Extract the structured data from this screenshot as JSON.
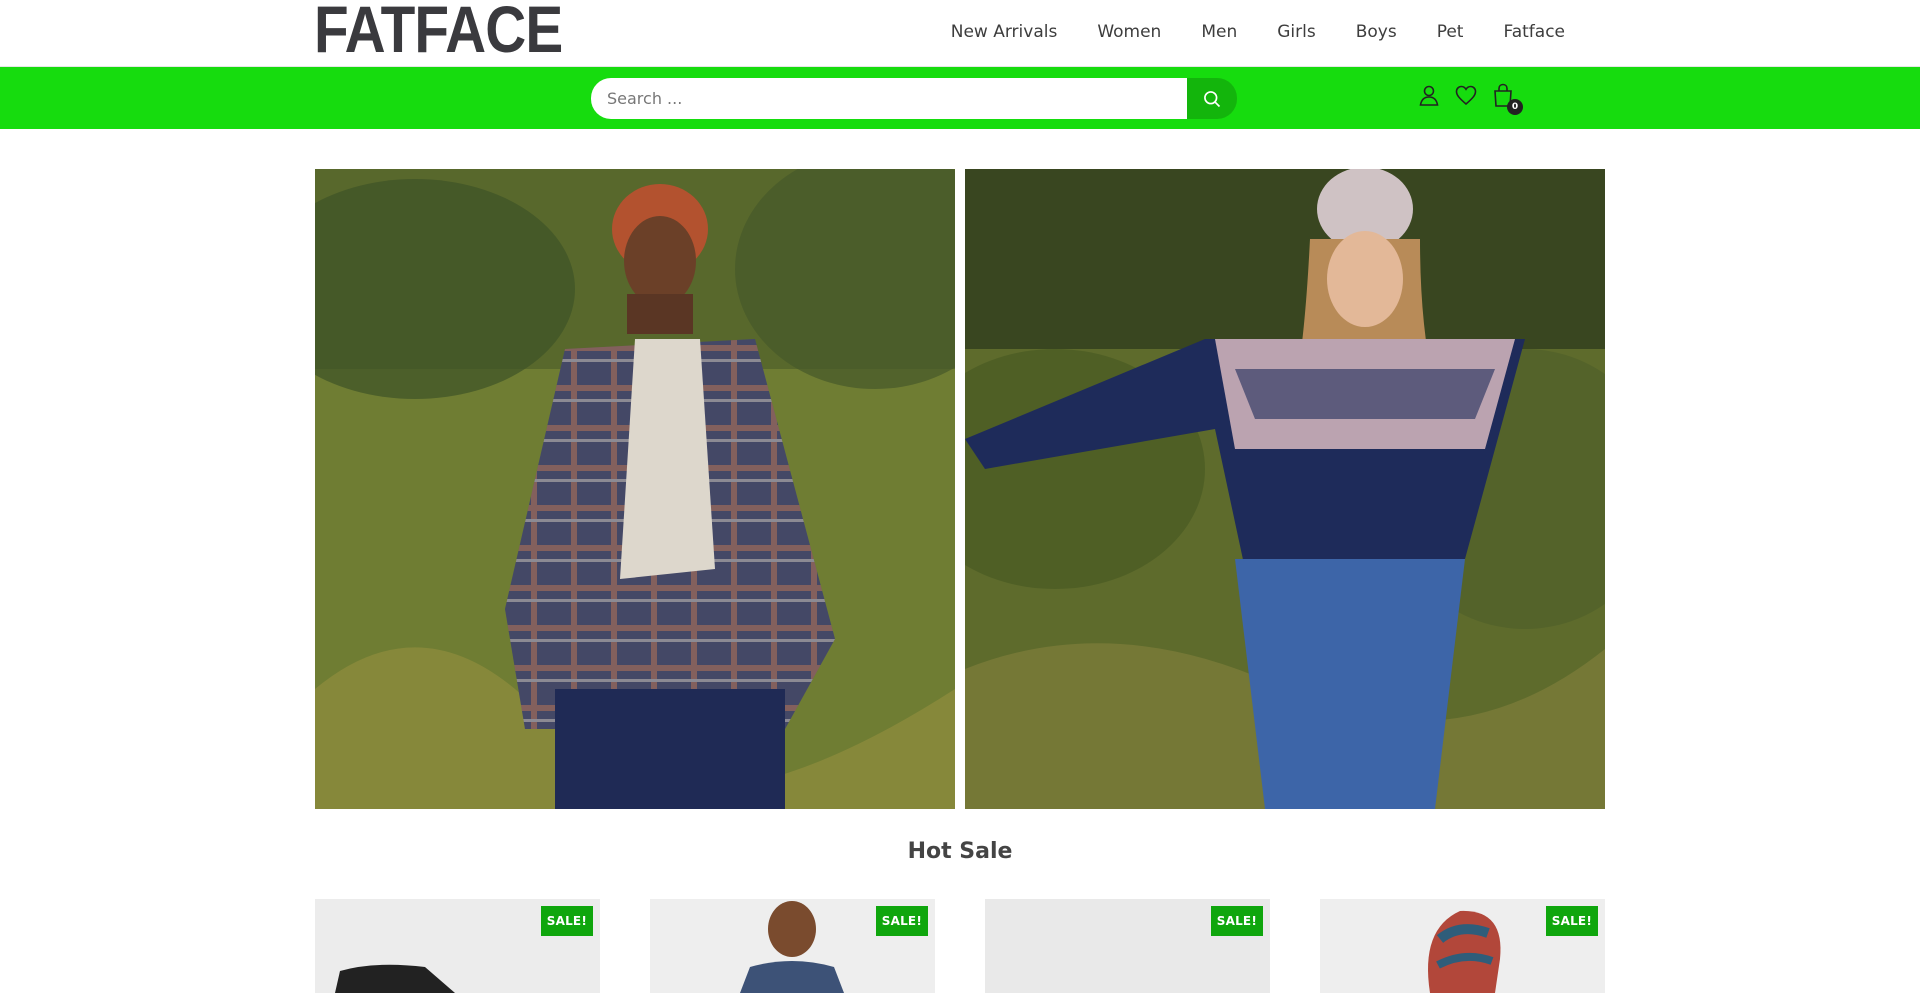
{
  "header": {
    "logo_text": "FATFACE",
    "nav_items": [
      {
        "label": "New Arrivals"
      },
      {
        "label": "Women"
      },
      {
        "label": "Men"
      },
      {
        "label": "Girls"
      },
      {
        "label": "Boys"
      },
      {
        "label": "Pet"
      },
      {
        "label": "Fatface"
      }
    ]
  },
  "search": {
    "placeholder": "Search ...",
    "button_icon": "search-icon"
  },
  "account_icons": {
    "user_icon": "user-icon",
    "wishlist_icon": "heart-icon",
    "cart_icon": "shopping-bag-icon",
    "cart_count": "0"
  },
  "hero": {
    "left_image": "man-in-plaid-shirt-and-beanie-photo",
    "right_image": "woman-in-fair-isle-sweater-photo"
  },
  "section": {
    "title": "Hot Sale"
  },
  "products": [
    {
      "badge": "SALE!"
    },
    {
      "badge": "SALE!"
    },
    {
      "badge": "SALE!"
    },
    {
      "badge": "SALE!"
    }
  ],
  "colors": {
    "accent_green": "#16dc0e",
    "badge_green": "#0fa60d",
    "search_button": "#13b50c"
  }
}
